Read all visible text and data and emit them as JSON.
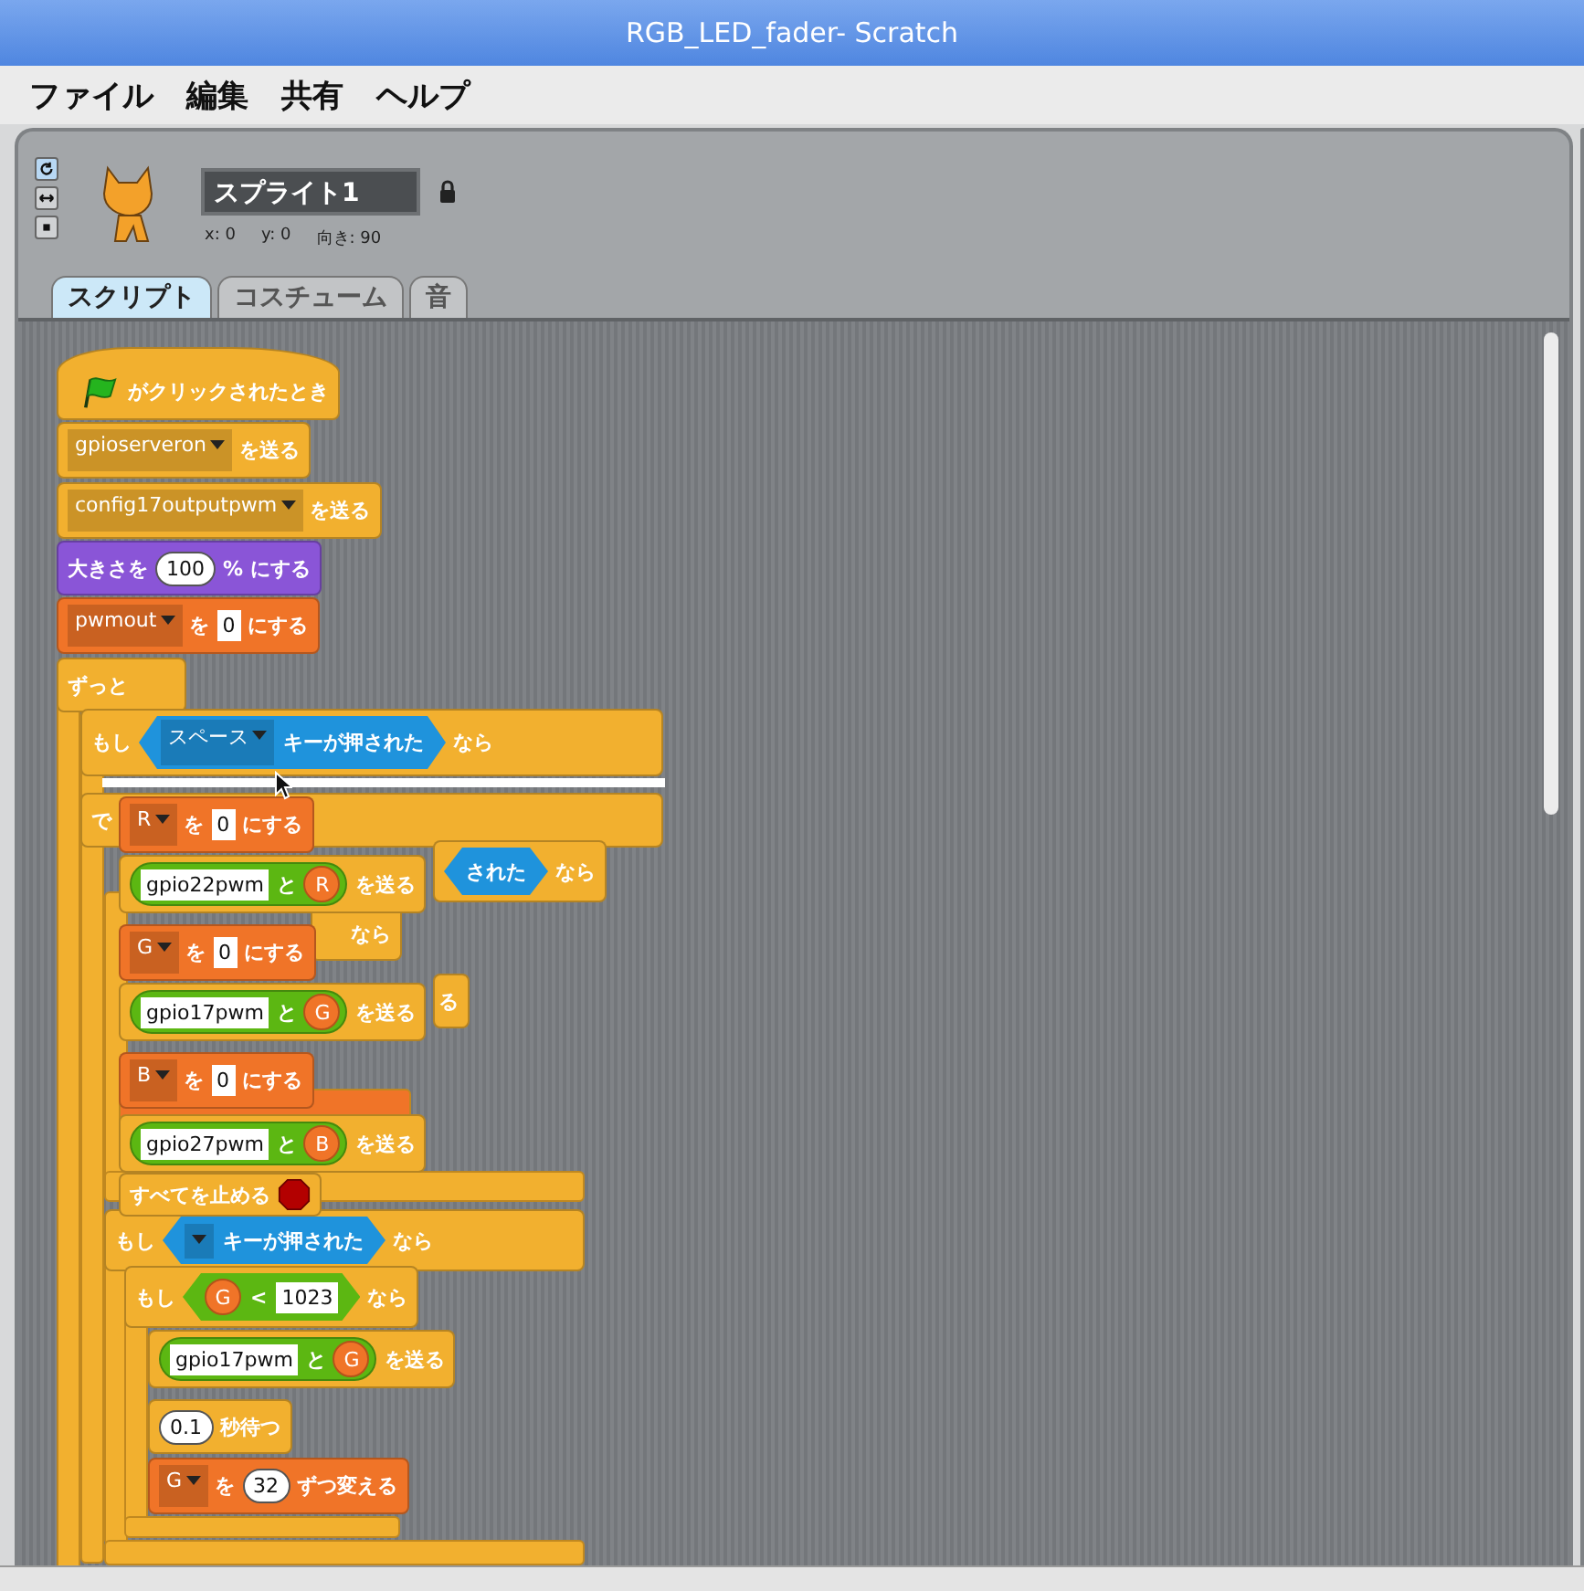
{
  "window": {
    "title": "RGB_LED_fader- Scratch"
  },
  "menu": [
    "ファイル",
    "編集",
    "共有",
    "ヘルプ"
  ],
  "sprite": {
    "name": "スプライト1",
    "locked": true,
    "x": "x: 0",
    "y": "y: 0",
    "direction": "向き: 90"
  },
  "rotation_styles": [
    {
      "selected": true
    },
    {
      "selected": false
    },
    {
      "selected": false
    }
  ],
  "tabs": [
    {
      "label": "スクリプト",
      "selected": true
    },
    {
      "label": "コスチューム",
      "selected": false
    },
    {
      "label": "音",
      "selected": false
    }
  ],
  "blocks": [
    {
      "color": "#f2b02f",
      "kind": "hat",
      "parts": [
        {
          "kind": "flag"
        },
        {
          "kind": "text",
          "text": "がクリックされたとき"
        }
      ]
    },
    {
      "color": "#f2b02f",
      "kind": "stack",
      "parts": [
        {
          "kind": "dropdown",
          "text": "gpioserveron"
        },
        {
          "kind": "text",
          "text": "を送る"
        }
      ]
    },
    {
      "color": "#f2b02f",
      "kind": "stack",
      "parts": [
        {
          "kind": "dropdown",
          "text": "config17outputpwm"
        },
        {
          "kind": "text",
          "text": "を送る"
        }
      ]
    },
    {
      "color": "#8a55d7",
      "kind": "stack",
      "parts": [
        {
          "kind": "text",
          "text": "大きさを"
        },
        {
          "kind": "round",
          "text": "100"
        },
        {
          "kind": "text",
          "text": "%"
        },
        {
          "kind": "text",
          "text": "にする"
        }
      ]
    },
    {
      "color": "#f07428",
      "kind": "stack",
      "parts": [
        {
          "kind": "dropdown",
          "text": "pwmout"
        },
        {
          "kind": "text",
          "text": "を"
        },
        {
          "kind": "number",
          "text": "0"
        },
        {
          "kind": "text",
          "text": "にする"
        }
      ]
    },
    {
      "color": "#f2b02f",
      "kind": "stack",
      "parts": [
        {
          "kind": "text",
          "text": "ずっと"
        }
      ]
    },
    {
      "color": "#f2b02f",
      "kind": "stack",
      "parts": [
        {
          "kind": "text",
          "text": "もし"
        },
        {
          "kind": "bool",
          "color": "#1f93dc",
          "parts": [
            {
              "kind": "dropdown",
              "text": "スペース"
            },
            {
              "kind": "text",
              "text": "キーが押された"
            }
          ]
        },
        {
          "kind": "text",
          "text": "なら"
        }
      ]
    },
    {
      "color": "#f2b02f",
      "kind": "stack",
      "parts": [
        {
          "kind": "text",
          "text": "で"
        }
      ]
    },
    {
      "color": "#f07428",
      "kind": "stack",
      "parts": [
        {
          "kind": "dropdown",
          "text": "R"
        },
        {
          "kind": "text",
          "text": "を"
        },
        {
          "kind": "number",
          "text": "0"
        },
        {
          "kind": "text",
          "text": "にする"
        }
      ]
    },
    {
      "color": "#f2b02f",
      "kind": "stack",
      "parts": [
        {
          "kind": "reporter",
          "color": "#5cb712",
          "parts": [
            {
              "kind": "string",
              "text": "gpio22pwm"
            },
            {
              "kind": "text",
              "text": "と"
            },
            {
              "kind": "variable",
              "text": "R"
            }
          ]
        },
        {
          "kind": "text",
          "text": "を送る"
        }
      ]
    },
    {
      "color": "#f07428",
      "kind": "stack",
      "parts": [
        {
          "kind": "dropdown",
          "text": "G"
        },
        {
          "kind": "text",
          "text": "を"
        },
        {
          "kind": "number",
          "text": "0"
        },
        {
          "kind": "text",
          "text": "にする"
        }
      ]
    },
    {
      "color": "#f2b02f",
      "kind": "stack",
      "parts": [
        {
          "kind": "reporter",
          "color": "#5cb712",
          "parts": [
            {
              "kind": "string",
              "text": "gpio17pwm"
            },
            {
              "kind": "text",
              "text": "と"
            },
            {
              "kind": "variable",
              "text": "G"
            }
          ]
        },
        {
          "kind": "text",
          "text": "を送る"
        }
      ]
    },
    {
      "color": "#f07428",
      "kind": "stack",
      "parts": [
        {
          "kind": "dropdown",
          "text": "B"
        },
        {
          "kind": "text",
          "text": "を"
        },
        {
          "kind": "number",
          "text": "0"
        },
        {
          "kind": "text",
          "text": "にする"
        }
      ]
    },
    {
      "color": "#f2b02f",
      "kind": "stack",
      "parts": [
        {
          "kind": "reporter",
          "color": "#5cb712",
          "parts": [
            {
              "kind": "string",
              "text": "gpio27pwm"
            },
            {
              "kind": "text",
              "text": "と"
            },
            {
              "kind": "variable",
              "text": "B"
            }
          ]
        },
        {
          "kind": "text",
          "text": "を送る"
        }
      ]
    },
    {
      "color": "#f2b02f",
      "kind": "stack",
      "parts": [
        {
          "kind": "text",
          "text": "すべてを止める"
        },
        {
          "kind": "stop"
        }
      ]
    },
    {
      "color": "#f2b02f",
      "kind": "stack",
      "parts": [
        {
          "kind": "bool",
          "color": "#1f93dc",
          "parts": [
            {
              "kind": "text",
              "text": "された"
            }
          ]
        },
        {
          "kind": "text",
          "text": "なら"
        }
      ]
    },
    {
      "color": "#f2b02f",
      "kind": "stack",
      "parts": [
        {
          "kind": "text",
          "text": "なら"
        }
      ]
    },
    {
      "color": "#f2b02f",
      "kind": "stack",
      "parts": [
        {
          "kind": "text",
          "text": "る"
        }
      ]
    },
    {
      "color": "#f2b02f",
      "kind": "stack",
      "parts": [
        {
          "kind": "text",
          "text": "もし"
        },
        {
          "kind": "bool",
          "color": "#1f93dc",
          "parts": [
            {
              "kind": "dropdown"
            },
            {
              "kind": "text",
              "text": "キーが押された"
            }
          ]
        },
        {
          "kind": "text",
          "text": "なら"
        }
      ]
    },
    {
      "color": "#f2b02f",
      "kind": "stack",
      "parts": [
        {
          "kind": "text",
          "text": "もし"
        },
        {
          "kind": "bool",
          "color": "#5cb712",
          "parts": [
            {
              "kind": "variable",
              "text": "G"
            },
            {
              "kind": "text",
              "text": "<"
            },
            {
              "kind": "number",
              "text": "1023"
            }
          ]
        },
        {
          "kind": "text",
          "text": "なら"
        }
      ]
    },
    {
      "color": "#f2b02f",
      "kind": "stack",
      "parts": [
        {
          "kind": "reporter",
          "color": "#5cb712",
          "parts": [
            {
              "kind": "string",
              "text": "gpio17pwm"
            },
            {
              "kind": "text",
              "text": "と"
            },
            {
              "kind": "variable",
              "text": "G"
            }
          ]
        },
        {
          "kind": "text",
          "text": "を送る"
        }
      ]
    },
    {
      "color": "#f2b02f",
      "kind": "stack",
      "parts": [
        {
          "kind": "round",
          "text": "0.1"
        },
        {
          "kind": "text",
          "text": "秒待つ"
        }
      ]
    },
    {
      "color": "#f07428",
      "kind": "stack",
      "parts": [
        {
          "kind": "dropdown",
          "text": "G"
        },
        {
          "kind": "text",
          "text": "を"
        },
        {
          "kind": "round",
          "text": "32"
        },
        {
          "kind": "text",
          "text": "ずつ変える"
        }
      ]
    }
  ]
}
